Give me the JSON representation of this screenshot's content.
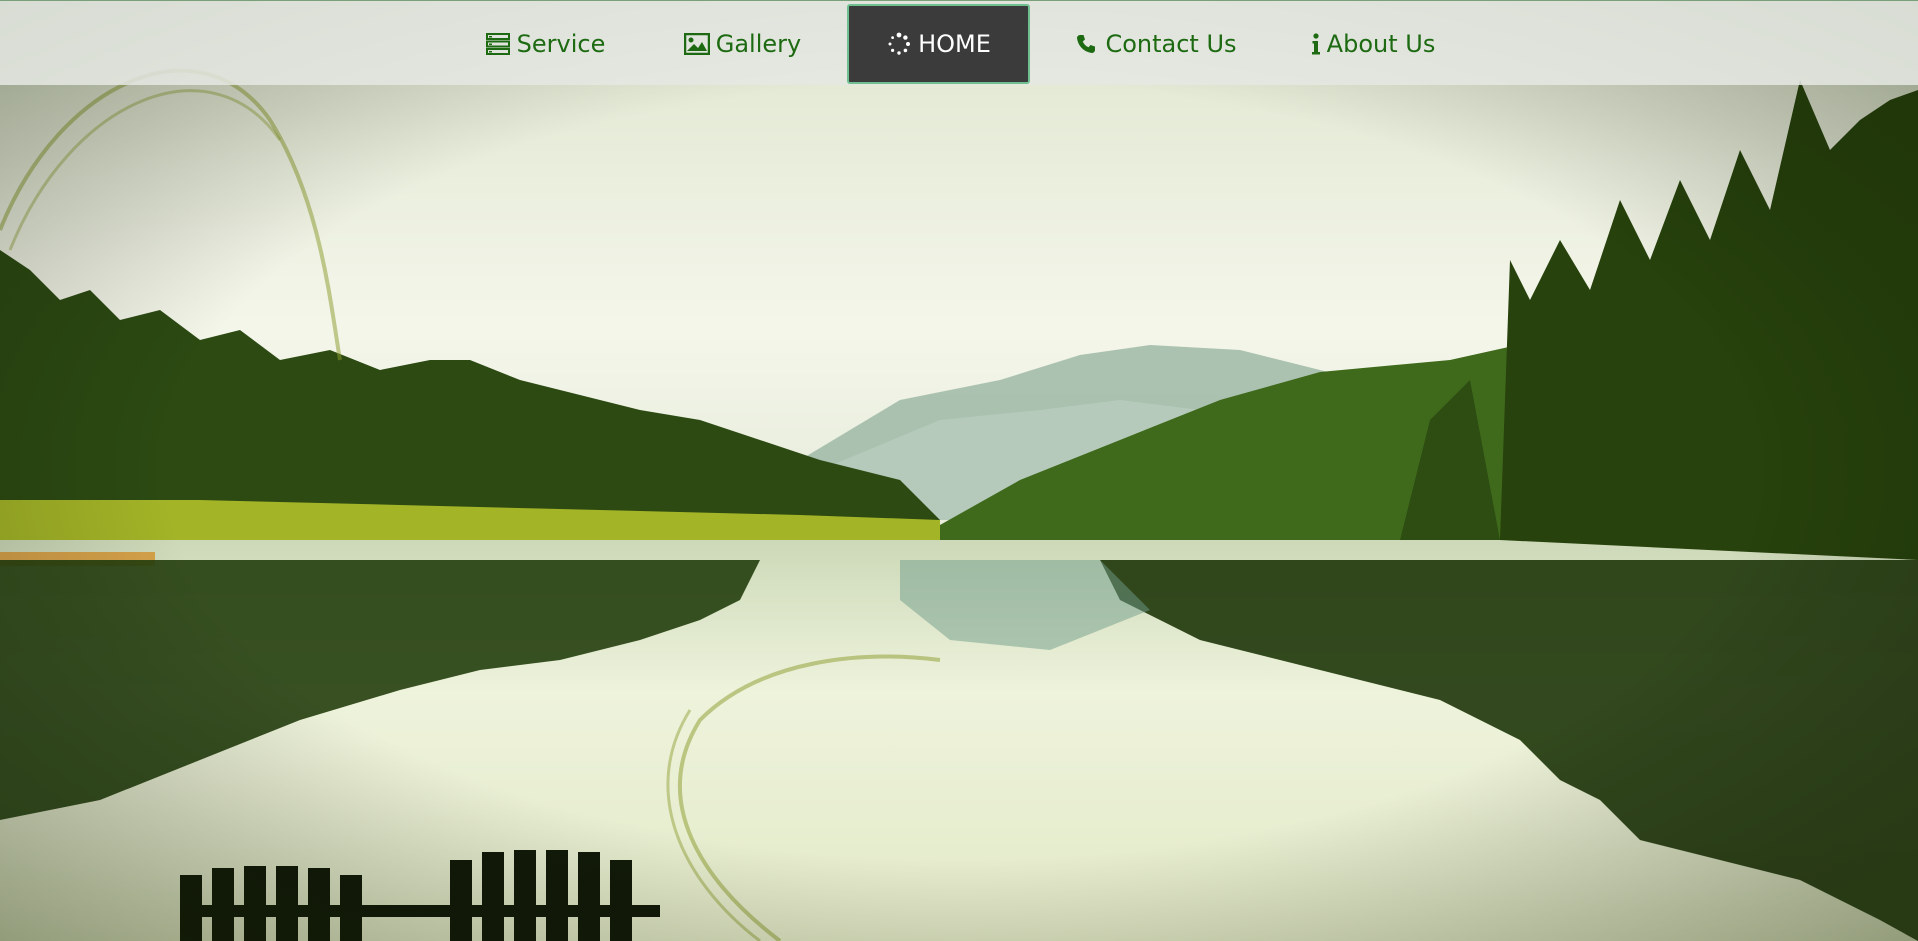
{
  "nav": {
    "items": [
      {
        "label": "Service",
        "icon": "list-icon",
        "active": false
      },
      {
        "label": "Gallery",
        "icon": "image-icon",
        "active": false
      },
      {
        "label": "HOME",
        "icon": "spinner-icon",
        "active": true
      },
      {
        "label": "Contact Us",
        "icon": "phone-icon",
        "active": false
      },
      {
        "label": "About Us",
        "icon": "info-icon",
        "active": false
      }
    ]
  },
  "colors": {
    "nav_text": "#1d6a12",
    "active_bg": "#3b3b3b",
    "active_border": "#6fbf91",
    "navbar_bg": "#e4e8e2"
  }
}
